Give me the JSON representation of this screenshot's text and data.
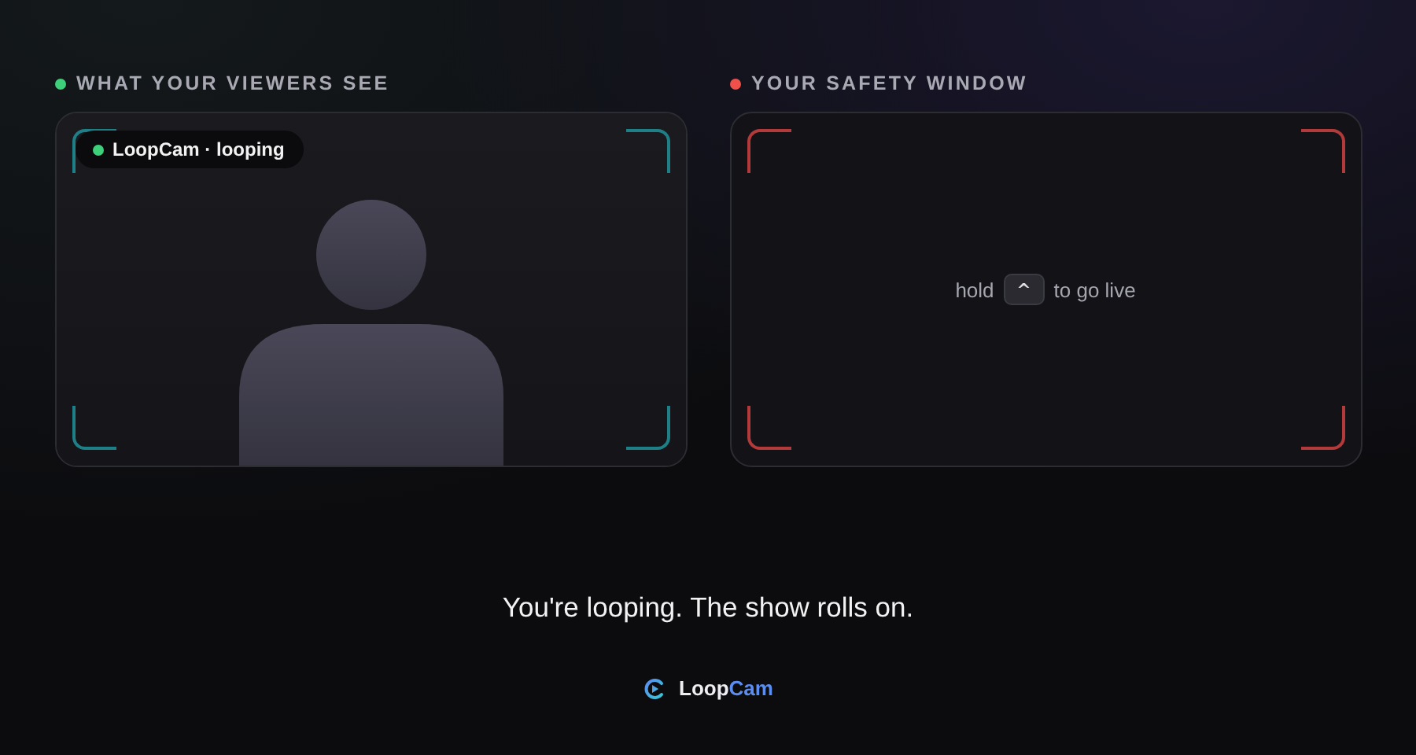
{
  "panels": [
    {
      "kind": "feed",
      "label": "WHAT YOUR VIEWERS SEE",
      "color": "#3ecf7a",
      "badge": {
        "text": "LoopCam · looping",
        "color": "#3ecf7a"
      }
    },
    {
      "kind": "safety",
      "label": "YOUR SAFETY WINDOW",
      "color": "#f0504a",
      "hint": {
        "before": "hold",
        "key": "^",
        "after": "to go live"
      }
    }
  ],
  "message": "You're looping. The show rolls on.",
  "brand": {
    "first": "Loop",
    "second": "Cam"
  }
}
